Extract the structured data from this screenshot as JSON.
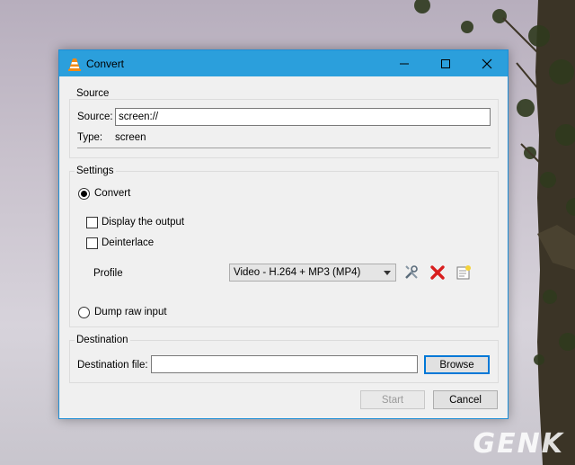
{
  "window": {
    "title": "Convert",
    "controls": {
      "minimize": "minimize",
      "maximize": "maximize",
      "close": "close"
    }
  },
  "source": {
    "group_title": "Source",
    "source_label": "Source:",
    "source_value": "screen://",
    "type_label": "Type:",
    "type_value": "screen"
  },
  "settings": {
    "group_title": "Settings",
    "convert_label": "Convert",
    "convert_selected": true,
    "display_output_label": "Display the output",
    "display_output_checked": false,
    "deinterlace_label": "Deinterlace",
    "deinterlace_checked": false,
    "profile_label": "Profile",
    "profile_value": "Video - H.264 + MP3 (MP4)",
    "dump_raw_label": "Dump raw input",
    "dump_raw_selected": false
  },
  "destination": {
    "group_title": "Destination",
    "file_label": "Destination file:",
    "file_value": "",
    "browse_label": "Browse"
  },
  "actions": {
    "start_label": "Start",
    "cancel_label": "Cancel"
  },
  "watermark": "GENK",
  "colors": {
    "titlebar": "#2b9fdc",
    "accent": "#0078d7",
    "delete_icon": "#d81e1e"
  }
}
